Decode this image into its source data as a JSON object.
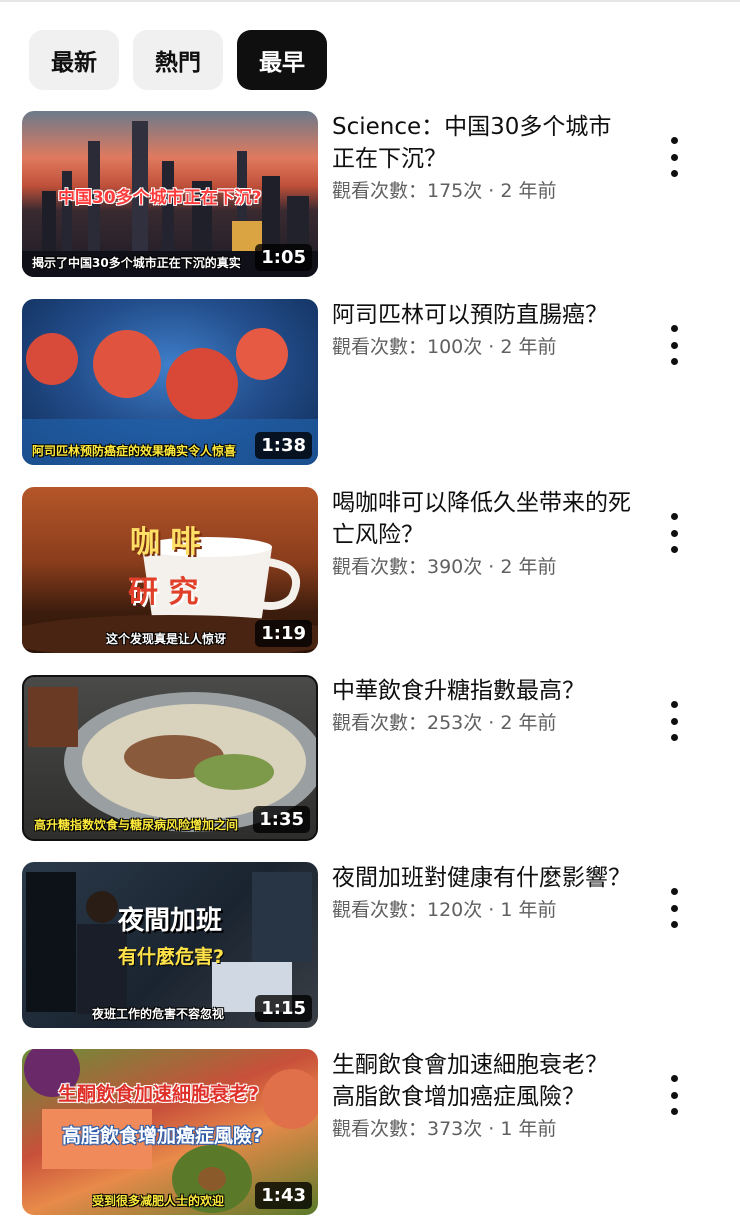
{
  "filters": [
    {
      "label": "最新",
      "active": false
    },
    {
      "label": "熱門",
      "active": false
    },
    {
      "label": "最早",
      "active": true
    }
  ],
  "videos": [
    {
      "title": "Science：中国30多个城市正在下沉？",
      "meta": "觀看次數：175次 · 2 年前",
      "duration": "1:05",
      "thumb_title": "中国30多个城市正在下沉?",
      "thumb_caption": "揭示了中国30多个城市正在下沉的真实"
    },
    {
      "title": "阿司匹林可以預防直腸癌？",
      "meta": "觀看次數：100次 · 2 年前",
      "duration": "1:38",
      "thumb_title": "",
      "thumb_caption": "阿司匹林预防癌症的效果确实令人惊喜"
    },
    {
      "title": "喝咖啡可以降低久坐带来的死亡风险？",
      "meta": "觀看次數：390次 · 2 年前",
      "duration": "1:19",
      "thumb_title": "咖 啡",
      "thumb_title2": "研 究",
      "thumb_caption": "这个发现真是让人惊讶"
    },
    {
      "title": "中華飲食升糖指數最高？",
      "meta": "觀看次數：253次 · 2 年前",
      "duration": "1:35",
      "thumb_title": "",
      "thumb_caption": "高升糖指数饮食与糖尿病风险增加之间"
    },
    {
      "title": "夜間加班對健康有什麼影響？",
      "meta": "觀看次數：120次 · 1 年前",
      "duration": "1:15",
      "thumb_title": "夜間加班",
      "thumb_title2": "有什麼危害?",
      "thumb_caption": "夜班工作的危害不容忽视"
    },
    {
      "title": "生酮飲食會加速細胞衰老？ 高脂飲食增加癌症風險？",
      "meta": "觀看次數：373次 · 1 年前",
      "duration": "1:43",
      "thumb_title": "生酮飲食加速細胞衰老?",
      "thumb_title2": "高脂飲食增加癌症風險?",
      "thumb_caption": "受到很多减肥人士的欢迎"
    }
  ]
}
